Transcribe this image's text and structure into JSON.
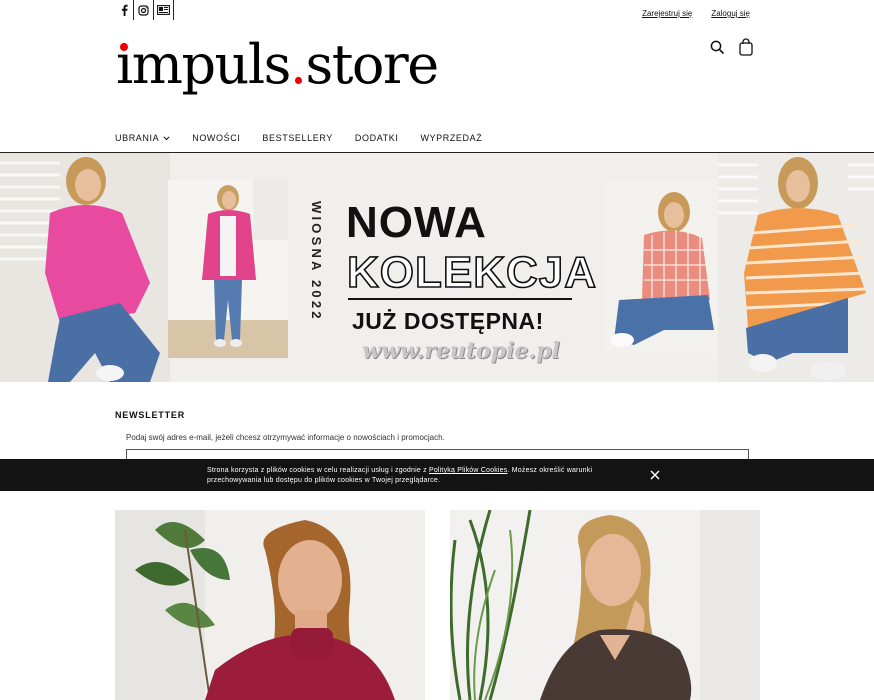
{
  "social": [
    {
      "icon": "facebook-icon",
      "glyph": "f"
    },
    {
      "icon": "instagram-icon",
      "glyph": "◎"
    },
    {
      "icon": "newspaper-icon",
      "glyph": "▤"
    }
  ],
  "account": {
    "register": "Zarejestruj się",
    "login": "Zaloguj się"
  },
  "logo": {
    "part1": "impuls",
    "dot": ".",
    "part2": "store"
  },
  "nav": {
    "items": [
      "UBRANIA",
      "NOWOŚCI",
      "BESTSELLERY",
      "DODATKI",
      "WYPRZEDAŻ"
    ]
  },
  "banner": {
    "season": "WIOSNA 2022",
    "line1": "NOWA",
    "line2": "KOLEKCJA",
    "line3": "JUŻ DOSTĘPNA!",
    "url": "www.reutopie.pl"
  },
  "newsletter": {
    "title": "NEWSLETTER",
    "desc": "Podaj swój adres e-mail, jeżeli chcesz otrzymywać informacje o nowościach i promocjach.",
    "placeholder": ""
  },
  "cookie": {
    "before": "Strona korzysta z plików cookies w celu realizacji usług i zgodnie z ",
    "link": "Polityką Plików Cookies",
    "after": ". Możesz określić warunki przechowywania lub dostępu do plików cookies w Twojej przeglądarce."
  },
  "colors": {
    "accent": "#e00000",
    "cookie_bg": "#131313",
    "banner_bg": "#f1efec"
  }
}
